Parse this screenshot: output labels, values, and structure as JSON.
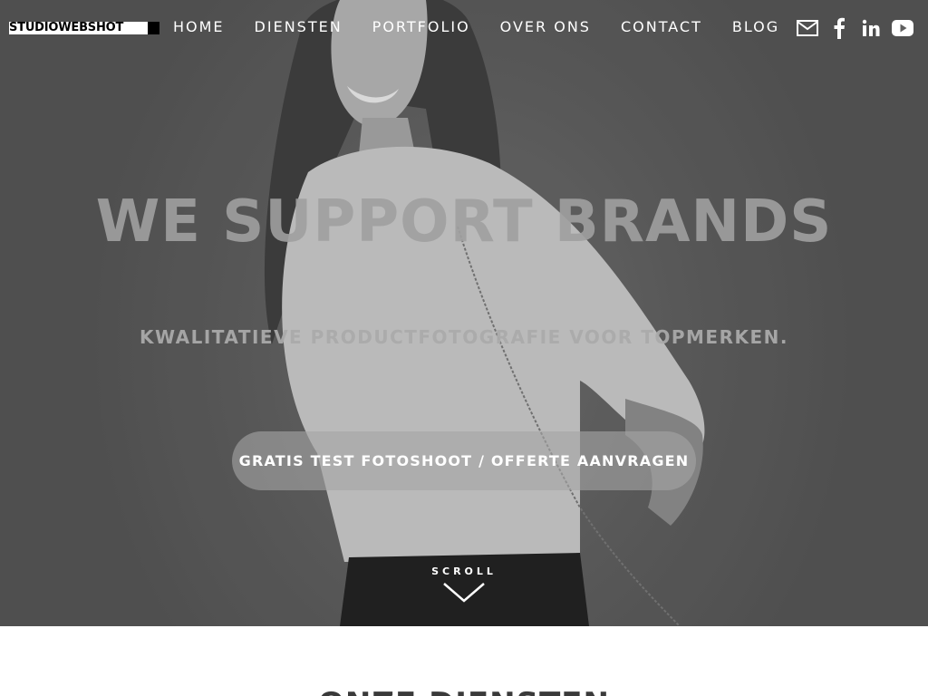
{
  "brand": {
    "logo_text": "STUDIOWEBSHOT"
  },
  "nav": {
    "items": [
      "HOME",
      "DIENSTEN",
      "PORTFOLIO",
      "OVER ONS",
      "CONTACT",
      "BLOG"
    ]
  },
  "social": [
    "mail-icon",
    "facebook-icon",
    "linkedin-icon",
    "youtube-icon"
  ],
  "hero": {
    "headline": "WE SUPPORT BRANDS",
    "subline": "KWALITATIEVE PRODUCTFOTOGRAFIE VOOR TOPMERKEN.",
    "cta_label": "GRATIS TEST FOTOSHOOT / OFFERTE AANVRAGEN",
    "scroll_label": "SCROLL"
  },
  "next_section": {
    "title": "ONZE DIENSTEN"
  },
  "colors": {
    "hero_bg": "#5f5f5f",
    "text": "#ffffff",
    "cta_bg": "#a5a5a5"
  }
}
